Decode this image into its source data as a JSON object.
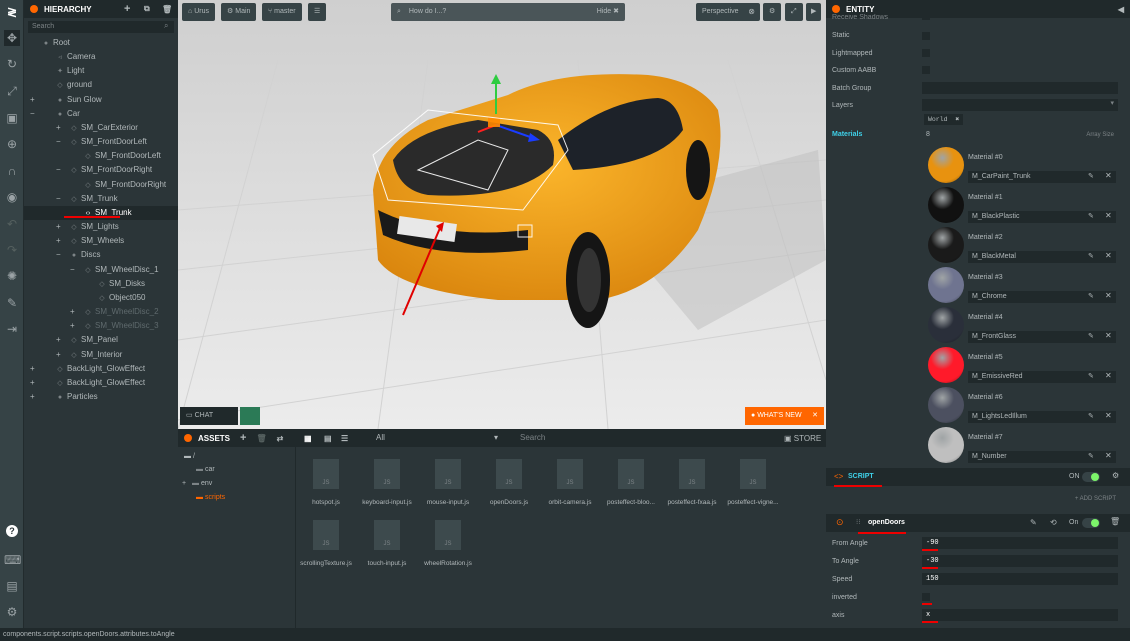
{
  "toolbar": {
    "icons": [
      "playcanvas-logo",
      "move-icon",
      "rotate-icon",
      "scale-icon",
      "resize-icon",
      "world-icon",
      "magnet-icon",
      "eye-icon",
      "undo-icon",
      "redo-icon",
      "lightmap-icon",
      "edit-icon",
      "publish-icon",
      "help-icon",
      "keyboard-icon",
      "chat-icon",
      "settings-icon"
    ]
  },
  "hierarchy": {
    "title": "HIERARCHY",
    "search_placeholder": "Search",
    "items": [
      {
        "label": "Root",
        "indent": 0,
        "expander": "",
        "icon": "dot"
      },
      {
        "label": "Camera",
        "indent": 1,
        "expander": "",
        "icon": "cam"
      },
      {
        "label": "Light",
        "indent": 1,
        "expander": "",
        "icon": "light"
      },
      {
        "label": "ground",
        "indent": 1,
        "expander": "",
        "icon": "cube"
      },
      {
        "label": "Sun Glow",
        "indent": 1,
        "expander": "+",
        "icon": "dot"
      },
      {
        "label": "Car",
        "indent": 1,
        "expander": "−",
        "icon": "dot"
      },
      {
        "label": "SM_CarExterior",
        "indent": 2,
        "expander": "+",
        "icon": "cube"
      },
      {
        "label": "SM_FrontDoorLeft",
        "indent": 2,
        "expander": "−",
        "icon": "cube"
      },
      {
        "label": "SM_FrontDoorLeft",
        "indent": 3,
        "expander": "",
        "icon": "cube"
      },
      {
        "label": "SM_FrontDoorRight",
        "indent": 2,
        "expander": "−",
        "icon": "cube"
      },
      {
        "label": "SM_FrontDoorRight",
        "indent": 3,
        "expander": "",
        "icon": "cube"
      },
      {
        "label": "SM_Trunk",
        "indent": 2,
        "expander": "−",
        "icon": "cube"
      },
      {
        "label": "SM_Trunk",
        "indent": 3,
        "expander": "",
        "icon": "code",
        "selected": true
      },
      {
        "label": "SM_Lights",
        "indent": 2,
        "expander": "+",
        "icon": "cube"
      },
      {
        "label": "SM_Wheels",
        "indent": 2,
        "expander": "+",
        "icon": "cube"
      },
      {
        "label": "Discs",
        "indent": 2,
        "expander": "−",
        "icon": "dot"
      },
      {
        "label": "SM_WheelDisc_1",
        "indent": 3,
        "expander": "−",
        "icon": "cube"
      },
      {
        "label": "SM_Disks",
        "indent": 4,
        "expander": "",
        "icon": "cube"
      },
      {
        "label": "Object050",
        "indent": 4,
        "expander": "",
        "icon": "cube"
      },
      {
        "label": "SM_WheelDisc_2",
        "indent": 3,
        "expander": "+",
        "icon": "cube",
        "dim": true
      },
      {
        "label": "SM_WheelDisc_3",
        "indent": 3,
        "expander": "+",
        "icon": "cube",
        "dim": true
      },
      {
        "label": "SM_Panel",
        "indent": 2,
        "expander": "+",
        "icon": "cube"
      },
      {
        "label": "SM_Interior",
        "indent": 2,
        "expander": "+",
        "icon": "cube"
      },
      {
        "label": "BackLight_GlowEffect",
        "indent": 1,
        "expander": "+",
        "icon": "cube"
      },
      {
        "label": "BackLight_GlowEffect",
        "indent": 1,
        "expander": "+",
        "icon": "cube"
      },
      {
        "label": "Particles",
        "indent": 1,
        "expander": "+",
        "icon": "dot"
      }
    ]
  },
  "viewport": {
    "project": "Urus",
    "scene": "Main",
    "branch": "master",
    "search_placeholder": "How do I...?",
    "hide_label": "Hide",
    "camera": "Perspective",
    "chat_label": "CHAT",
    "whats_new": "WHAT'S NEW"
  },
  "assets": {
    "title": "ASSETS",
    "filter": "All",
    "search_placeholder": "Search",
    "store": "STORE",
    "tree": [
      "/",
      "car",
      "env",
      "scripts"
    ],
    "files": [
      "hotspot.js",
      "keyboard-input.js",
      "mouse-input.js",
      "openDoors.js",
      "orbit-camera.js",
      "posteffect-bloo...",
      "posteffect-fxaa.js",
      "posteffect-vigne...",
      "scrollingTexture.js",
      "touch-input.js",
      "wheelRotation.js"
    ],
    "file_icon_text": "JS"
  },
  "entity": {
    "title": "ENTITY",
    "rows": {
      "receive_shadows": "Receive Shadows",
      "static": "Static",
      "lightmapped": "Lightmapped",
      "custom_aabb": "Custom AABB",
      "batch_group": "Batch Group",
      "layers": "Layers"
    },
    "layer_tag": "World",
    "materials_label": "Materials",
    "materials_count": "8",
    "array_size": "Array Size",
    "materials": [
      {
        "label": "Material #0",
        "name": "M_CarPaint_Trunk",
        "color": "#e8920f"
      },
      {
        "label": "Material #1",
        "name": "M_BlackPlastic",
        "color": "#111111"
      },
      {
        "label": "Material #2",
        "name": "M_BlackMetal",
        "color": "#1a1a1a"
      },
      {
        "label": "Material #3",
        "name": "M_Chrome",
        "color": "#6f7490"
      },
      {
        "label": "Material #4",
        "name": "M_FrontGlass",
        "color": "#2a2f3a"
      },
      {
        "label": "Material #5",
        "name": "M_EmissiveRed",
        "color": "#ff1a2a"
      },
      {
        "label": "Material #6",
        "name": "M_LightsLedIllum",
        "color": "#4c5060"
      },
      {
        "label": "Material #7",
        "name": "M_Number",
        "color": "#bfbfbf"
      }
    ],
    "script_title": "SCRIPT",
    "script_on": "ON",
    "add_script": "+ ADD SCRIPT",
    "script_name": "openDoors",
    "script_toggle": "On",
    "attrs": [
      {
        "label": "From Angle",
        "value": "-90"
      },
      {
        "label": "To Angle",
        "value": "-30"
      },
      {
        "label": "Speed",
        "value": "150"
      },
      {
        "label": "inverted",
        "value": ""
      },
      {
        "label": "axis",
        "value": "x"
      }
    ]
  },
  "status": "components.script.scripts.openDoors.attributes.toAngle",
  "colors": {
    "accent": "#ff6600",
    "bg": "#2b3538",
    "dark": "#20292b",
    "toggle": "#7cf46a",
    "underline": "#e00000"
  }
}
